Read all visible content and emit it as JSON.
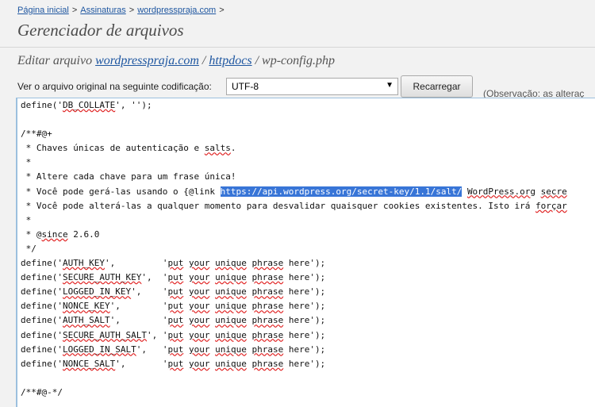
{
  "breadcrumb": {
    "items": [
      "Página inicial",
      "Assinaturas",
      "wordpresspraja.com"
    ],
    "separator": ">"
  },
  "page_title": "Gerenciador de arquivos",
  "edit_path": {
    "prefix": "Editar arquivo",
    "segments": [
      "wordpresspraja.com",
      "httpdocs",
      "wp-config.php"
    ],
    "separator": "/"
  },
  "encoding": {
    "label": "Ver o arquivo original na seguinte codificação:",
    "selected": "UTF-8",
    "reload_label": "Recarregar"
  },
  "note": "(Observação: as alteraç",
  "code_lines": [
    "define('DB_COLLATE', '');",
    "",
    "/**#@+",
    " * Chaves únicas de autenticação e salts.",
    " *",
    " * Altere cada chave para um frase única!",
    " * Você pode gerá-las usando o {@link https://api.wordpress.org/secret-key/1.1/salt/ WordPress.org secre",
    " * Você pode alterá-las a qualquer momento para desvalidar quaisquer cookies existentes. Isto irá forçar",
    " *",
    " * @since 2.6.0",
    " */",
    "define('AUTH_KEY',         'put your unique phrase here');",
    "define('SECURE_AUTH_KEY',  'put your unique phrase here');",
    "define('LOGGED_IN_KEY',    'put your unique phrase here');",
    "define('NONCE_KEY',        'put your unique phrase here');",
    "define('AUTH_SALT',        'put your unique phrase here');",
    "define('SECURE_AUTH_SALT', 'put your unique phrase here');",
    "define('LOGGED_IN_SALT',   'put your unique phrase here');",
    "define('NONCE_SALT',       'put your unique phrase here');",
    "",
    "/**#@-*/"
  ],
  "selected_text": "https://api.wordpress.org/secret-key/1.1/salt/",
  "spellcheck_words": [
    "DB_COLLATE",
    "salts",
    "since",
    "AUTH_KEY",
    "SECURE_AUTH_KEY",
    "LOGGED_IN_KEY",
    "NONCE_KEY",
    "AUTH_SALT",
    "SECURE_AUTH_SALT",
    "LOGGED_IN_SALT",
    "NONCE_SALT",
    "put",
    "your",
    "unique",
    "phrase",
    "WordPress.org",
    "secre",
    "forçar"
  ],
  "colors": {
    "link": "#1e56a0",
    "selection": "#3875d7",
    "editor_border": "#9cc0de",
    "spell_underline": "#e02020"
  }
}
